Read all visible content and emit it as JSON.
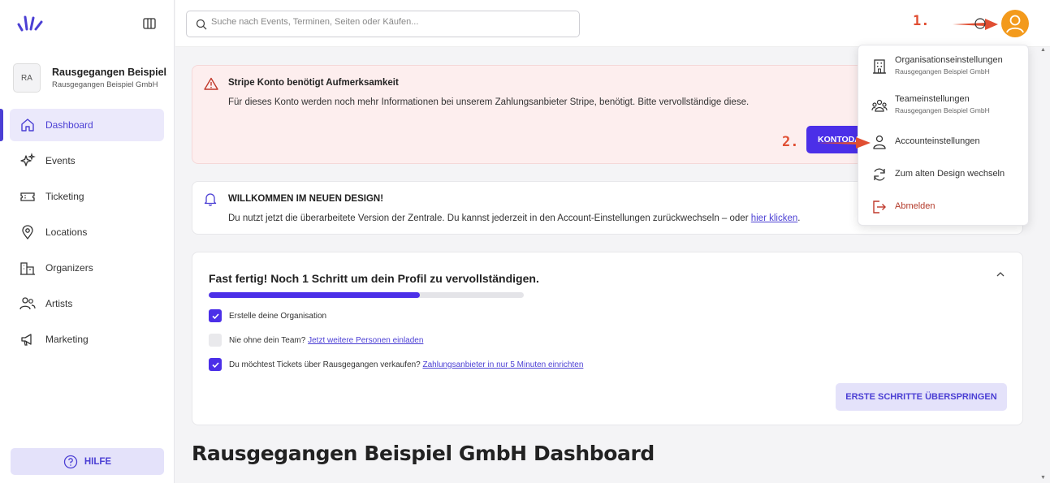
{
  "sidebar": {
    "org": {
      "initials": "RA",
      "name": "Rausgegangen Beispiel...",
      "subtitle": "Rausgegangen Beispiel GmbH"
    },
    "items": [
      {
        "label": "Dashboard",
        "icon": "home-icon",
        "active": true
      },
      {
        "label": "Events",
        "icon": "sparkles-icon"
      },
      {
        "label": "Ticketing",
        "icon": "ticket-icon"
      },
      {
        "label": "Locations",
        "icon": "map-pin-icon"
      },
      {
        "label": "Organizers",
        "icon": "buildings-icon"
      },
      {
        "label": "Artists",
        "icon": "users-icon"
      },
      {
        "label": "Marketing",
        "icon": "megaphone-icon"
      }
    ],
    "help_label": "HILFE"
  },
  "search": {
    "placeholder": "Suche nach Events, Terminen, Seiten oder Käufen..."
  },
  "annotations": {
    "step1": "1.",
    "step2": "2."
  },
  "alert": {
    "title": "Stripe Konto benötigt Aufmerksamkeit",
    "text": "Für dieses Konto werden noch mehr Informationen bei unserem Zahlungsanbieter Stripe, benötigt. Bitte vervollständige diese.",
    "button": "KONTODA"
  },
  "welcome": {
    "title": "WILLKOMMEN IM NEUEN DESIGN!",
    "text": "Du nutzt jetzt die überarbeitete Version der Zentrale. Du kannst jederzeit in den Account-Einstellungen zurückwechseln – oder ",
    "link": "hier klicken",
    "suffix": "."
  },
  "steps": {
    "title": "Fast fertig! Noch 1 Schritt um dein Profil zu vervollständigen.",
    "progress": 0.67,
    "items": [
      {
        "text": "Erstelle deine Organisation",
        "link": "",
        "checked": true
      },
      {
        "text": "Nie ohne dein Team? ",
        "link": "Jetzt weitere Personen einladen",
        "checked": false
      },
      {
        "text": "Du möchtest Tickets über Rausgegangen verkaufen? ",
        "link": "Zahlungsanbieter in nur 5 Minuten einrichten",
        "checked": true
      }
    ],
    "skip_label": "ERSTE SCHRITTE ÜBERSPRINGEN"
  },
  "dashboard_title": "Rausgegangen Beispiel GmbH Dashboard",
  "menu": {
    "org_settings": "Organisationseinstellungen",
    "org_settings_sub": "Rausgegangen Beispiel GmbH",
    "team_settings": "Teameinstellungen",
    "team_settings_sub": "Rausgegangen Beispiel GmbH",
    "account_settings": "Accounteinstellungen",
    "old_design": "Zum alten Design wechseln",
    "logout": "Abmelden"
  },
  "colors": {
    "accent": "#4b2fe8",
    "annotation": "#e04e32",
    "avatar": "#f39a1c",
    "alert_bg": "#fdeeee"
  }
}
